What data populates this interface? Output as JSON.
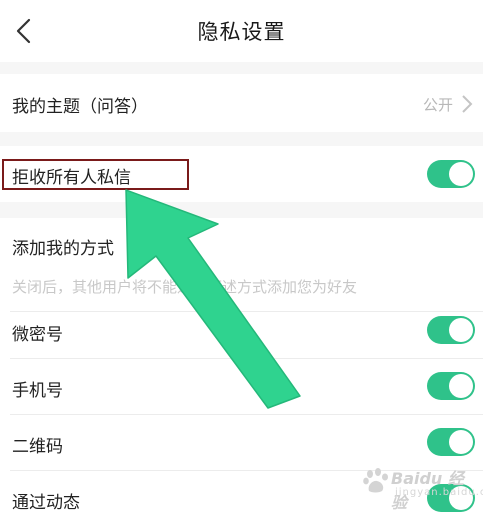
{
  "header": {
    "title": "隐私设置"
  },
  "topic": {
    "label": "我的主题（问答）",
    "value": "公开"
  },
  "reject": {
    "label": "拒收所有人私信",
    "enabled": true
  },
  "add": {
    "section_title": "添加我的方式",
    "hint": "关闭后，其他用户将不能通过下述方式添加您为好友",
    "items": [
      {
        "label": "微密号",
        "enabled": true
      },
      {
        "label": "手机号",
        "enabled": true
      },
      {
        "label": "二维码",
        "enabled": true
      },
      {
        "label": "通过动态",
        "enabled": true
      }
    ]
  },
  "watermark": {
    "text": "Baidu 经验",
    "sub": "jingyan.baidu.com"
  },
  "colors": {
    "toggle_on": "#2fc28a",
    "annotation_arrow": "#2fd38f",
    "annotation_box": "#7a1a1a"
  }
}
